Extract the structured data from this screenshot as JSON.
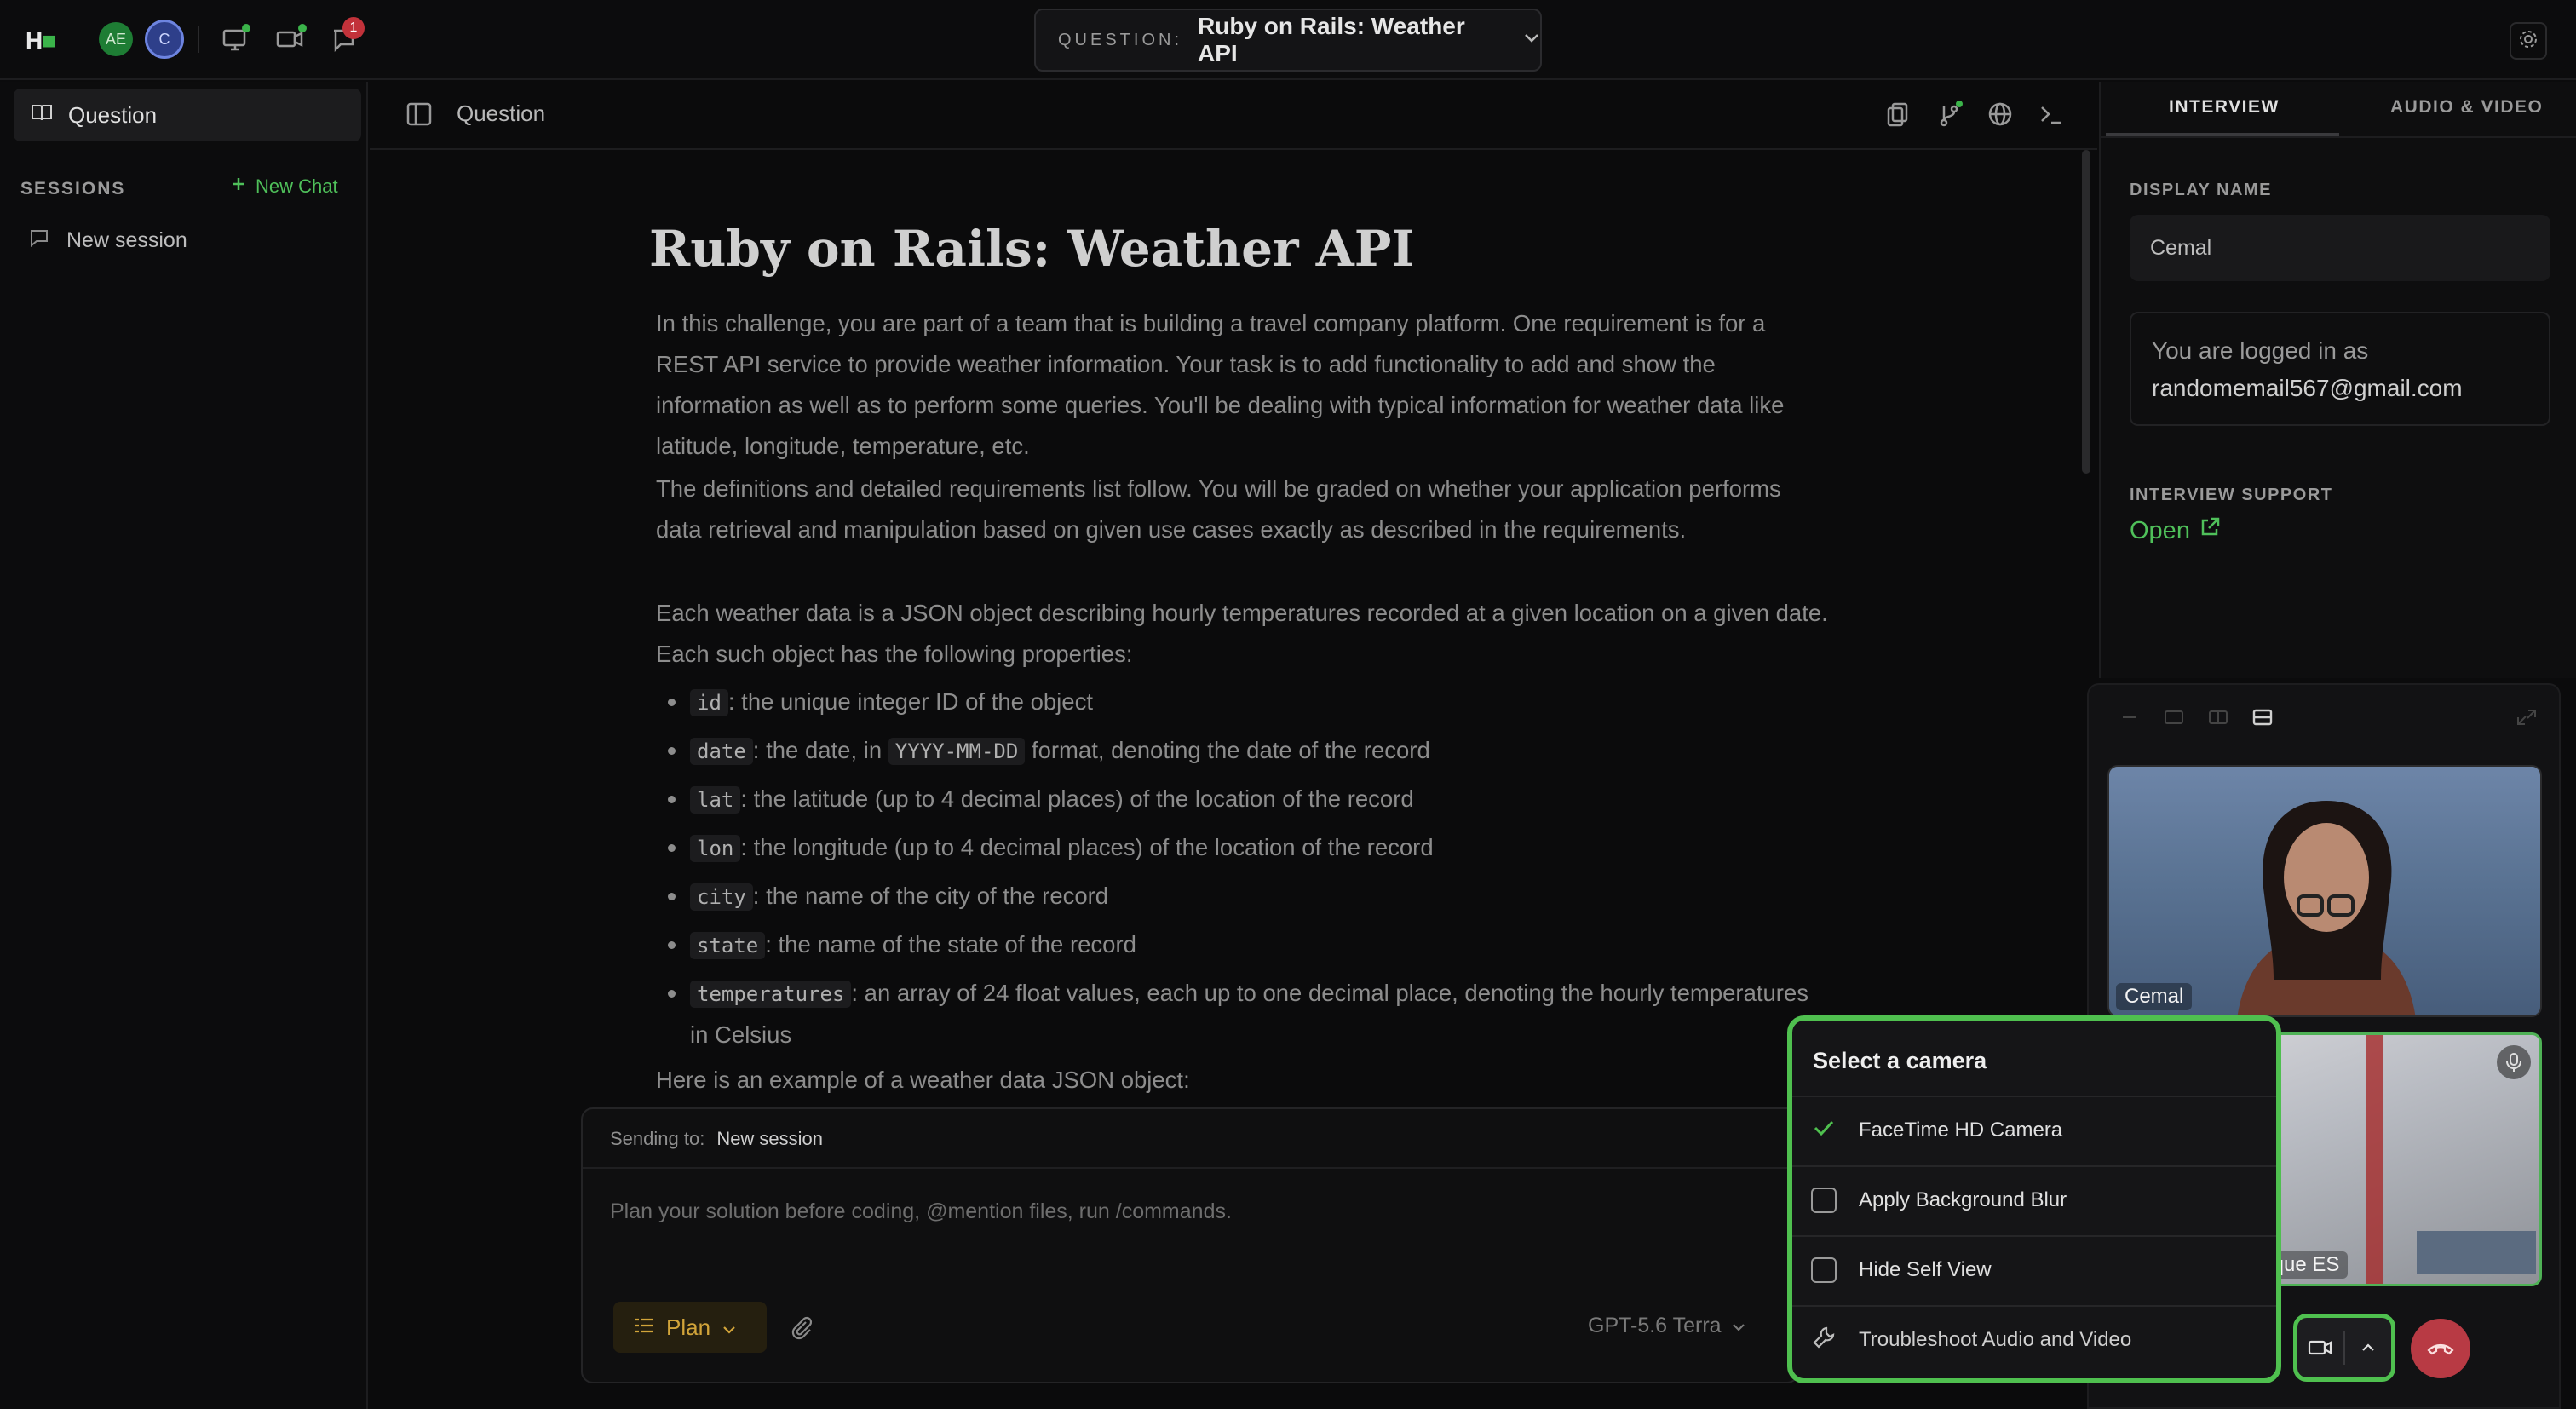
{
  "topbar": {
    "logo": "H",
    "avatars": [
      "AE",
      "C"
    ],
    "notification_count": "1",
    "question_label": "QUESTION:",
    "question_value": "Ruby on Rails: Weather API"
  },
  "sidebar": {
    "question_item": "Question",
    "sessions_label": "SESSIONS",
    "new_chat": "New Chat",
    "sessions": [
      "New session"
    ]
  },
  "main": {
    "header_title": "Question",
    "title": "Ruby on Rails: Weather API",
    "paragraphs": [
      "In this challenge, you are part of a team that is building a travel company platform. One requirement is for a REST API service to provide weather information. Your task is to add functionality to add and show the information as well as to perform some queries. You'll be dealing with typical information for weather data like latitude, longitude, temperature, etc.",
      "The definitions and detailed requirements list follow. You will be graded on whether your application performs data retrieval and manipulation based on given use cases exactly as described in the requirements.",
      "Each weather data is a JSON object describing hourly temperatures recorded at a given location on a given date. Each such object has the following properties:"
    ],
    "properties": [
      {
        "code": "id",
        "text": ": the unique integer ID of the object"
      },
      {
        "code": "date",
        "text_before": ": the date, in ",
        "code2": "YYYY-MM-DD",
        "text": " format, denoting the date of the record"
      },
      {
        "code": "lat",
        "text": ": the latitude (up to 4 decimal places) of the location of the record"
      },
      {
        "code": "lon",
        "text": ": the longitude (up to 4 decimal places) of the location of the record"
      },
      {
        "code": "city",
        "text": ": the name of the city of the record"
      },
      {
        "code": "state",
        "text": ": the name of the state of the record"
      },
      {
        "code": "temperatures",
        "text": ": an array of 24 float values, each up to one decimal place, denoting the hourly temperatures in Celsius"
      }
    ],
    "example_intro": "Here is an example of a weather data JSON object:"
  },
  "chat": {
    "sending_to_label": "Sending to:",
    "sending_to_value": "New session",
    "placeholder": "Plan your solution before coding, @mention files, run /commands.",
    "plan_label": "Plan",
    "model": "GPT-5.6 Terra"
  },
  "right_panel": {
    "tab_interview": "INTERVIEW",
    "tab_av": "AUDIO & VIDEO",
    "display_name_label": "DISPLAY NAME",
    "display_name_value": "Cemal",
    "logged_in_prefix": "You are logged in as",
    "logged_in_email": "randomemail567@gmail.com",
    "support_label": "INTERVIEW SUPPORT",
    "support_link": "Open"
  },
  "video": {
    "tile1_name": "Cemal",
    "tile2_name": "lique ES"
  },
  "camera_menu": {
    "title": "Select a camera",
    "items": [
      {
        "label": "FaceTime HD Camera",
        "checked": true
      },
      {
        "label": "Apply Background Blur",
        "checked": false
      },
      {
        "label": "Hide Self View",
        "checked": false
      },
      {
        "label": "Troubleshoot Audio and Video"
      }
    ]
  },
  "colors": {
    "accent_green": "#4fc04f",
    "plan_amber": "#d2a43a",
    "hangup_red": "#b83a44"
  }
}
